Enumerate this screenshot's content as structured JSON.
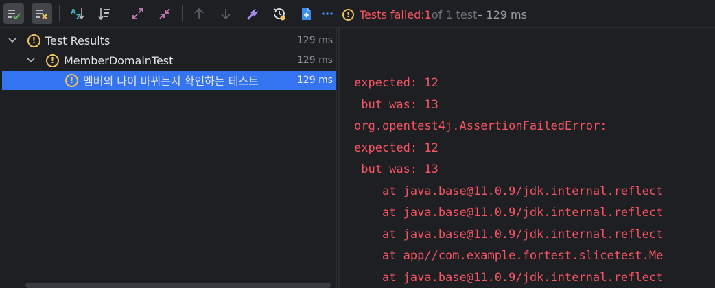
{
  "toolbar": {
    "buttons": [
      {
        "id": "show-passed",
        "icon": "check-list-icon"
      },
      {
        "id": "show-ignored",
        "icon": "ignored-list-icon"
      },
      {
        "id": "sort-alpha",
        "icon": "sort-alphabetically-icon"
      },
      {
        "id": "sort-duration",
        "icon": "sort-by-duration-icon"
      },
      {
        "id": "expand-all",
        "icon": "expand-all-icon"
      },
      {
        "id": "collapse-all",
        "icon": "collapse-all-icon"
      },
      {
        "id": "prev-failed",
        "icon": "arrow-up-icon"
      },
      {
        "id": "next-failed",
        "icon": "arrow-down-icon"
      },
      {
        "id": "import-tests",
        "icon": "import-icon"
      },
      {
        "id": "test-history",
        "icon": "history-icon"
      },
      {
        "id": "export-results",
        "icon": "export-icon"
      },
      {
        "id": "more",
        "icon": "more-icon"
      }
    ]
  },
  "status": {
    "icon": "warning-icon",
    "prefix": "Tests failed: ",
    "failed": "1",
    "of_total": " of 1 test",
    "duration": " – 129 ms"
  },
  "tree": {
    "rows": [
      {
        "label": "Test Results",
        "time": "129 ms",
        "icon": "warning-icon",
        "expanded": true
      },
      {
        "label": "MemberDomainTest",
        "time": "129 ms",
        "icon": "warning-icon",
        "expanded": true
      },
      {
        "label": "멤버의 나이 바뀌는지 확인하는 테스트",
        "time": "129 ms",
        "icon": "warning-icon",
        "selected": true
      }
    ]
  },
  "console": {
    "lines": [
      "expected: 12",
      " but was: 13",
      "org.opentest4j.AssertionFailedError:",
      "expected: 12",
      " but was: 13",
      "    at java.base@11.0.9/jdk.internal.reflect",
      "    at java.base@11.0.9/jdk.internal.reflect",
      "    at java.base@11.0.9/jdk.internal.reflect",
      "    at app//com.example.fortest.slicetest.Me",
      "    at java.base@11.0.9/jdk.internal.reflect"
    ]
  },
  "colors": {
    "background": "#1e1f22",
    "error_text": "#f75464",
    "warning": "#f2c55c",
    "selection": "#3574f0"
  }
}
